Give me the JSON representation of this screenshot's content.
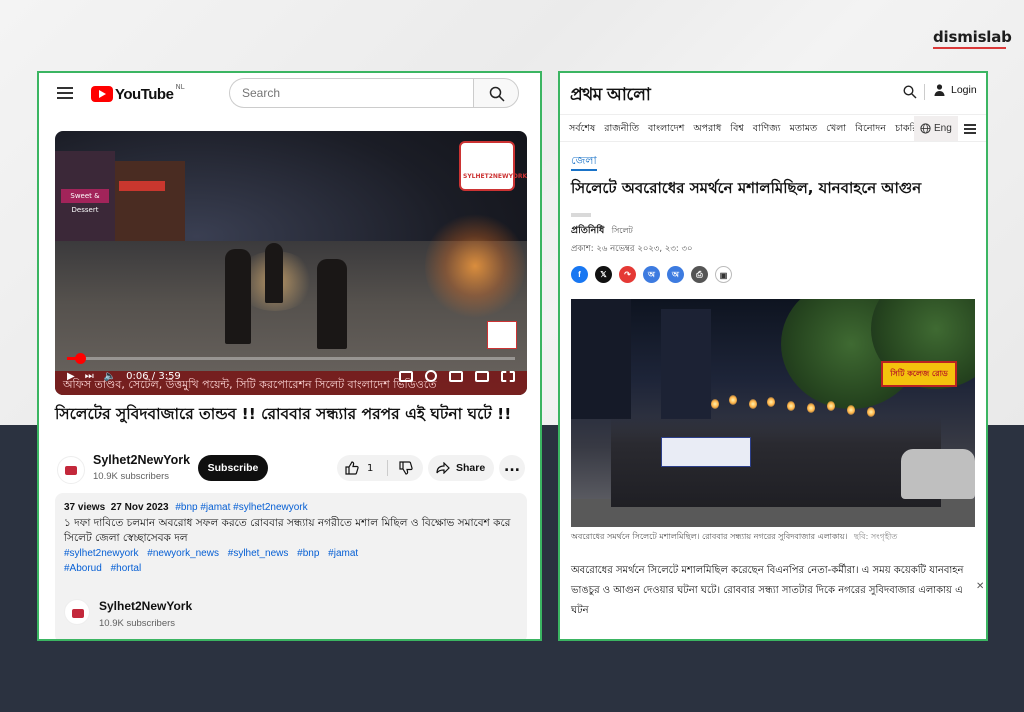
{
  "brand": {
    "name": "dismislab"
  },
  "youtube": {
    "logo_text": "YouTube",
    "region": "NL",
    "search": {
      "placeholder": "Search"
    },
    "video": {
      "shop_sign": "Sweet & Dessert",
      "badge_text": "SYLHET2NEWYORK",
      "ticker": "অফিস তাণ্ডব, সেটেল, উত্তমুখি পয়েন্ট, সিটি করপোরেশন সিলেট বাংলাদেশ ভিডিওতে",
      "time": "0:06 / 3:59",
      "progress": 0.028
    },
    "title": "সিলেটের সুবিদবাজারে তান্ডব !! রোববার সন্ধ্যার পরপর এই ঘটনা ঘটে !!",
    "channel": {
      "name": "Sylhet2NewYork",
      "subscribers": "10.9K subscribers"
    },
    "subscribe_label": "Subscribe",
    "likes": "1",
    "share_label": "Share",
    "more_label": "...",
    "description": {
      "views": "37 views",
      "date": "27 Nov 2023",
      "header_tags": "#bnp #jamat #sylhet2newyork",
      "text": "১ দফা দাবিতে চলমান অবরোধ সফল করতে রোববার সন্ধ্যায় নগরীতে মশাল মিছিল ও বিক্ষোভ সমাবেশ করে সিলেট জেলা স্বেচ্ছাসেবক দল",
      "tags": [
        "#sylhet2newyork",
        "#newyork_news",
        "#sylhet_news",
        "#bnp",
        "#jamat",
        "#Aborud",
        "#hortal"
      ],
      "channel_name": "Sylhet2NewYork",
      "channel_subscribers": "10.9K subscribers"
    }
  },
  "prothom_alo": {
    "logo_text": "প্রথম আলো",
    "login_label": "Login",
    "nav": [
      "সর্বশেষ",
      "রাজনীতি",
      "বাংলাদেশ",
      "অপরাধ",
      "বিশ্ব",
      "বাণিজ্য",
      "মতামত",
      "খেলা",
      "বিনোদন",
      "চাকরি"
    ],
    "lang_label": "Eng",
    "section": "জেলা",
    "headline": "সিলেটে অবরোধের সমর্থনে মশালমিছিল, যানবাহনে আগুন",
    "author": "প্রতিনিধি",
    "location": "সিলেট",
    "published": "প্রকাশ: ২৬ নভেম্বর ২০২৩, ২৩: ৩০",
    "photo_sign": "সিটি কলেজ রোড",
    "caption": "অবরোধের সমর্থনে সিলেটে মশালমিছিল। রোববার সন্ধ্যায় নগরের সুবিদবাজার এলাকায়।",
    "photo_credit": "ছবি: সংগৃহীত",
    "body": "অবরোধের সমর্থনে সিলেটে মশালমিছিল করেছেন বিএনপির নেতা-কর্মীরা। এ সময় কয়েকটি যানবাহন ভাঙচুর ও আগুন দেওয়ার ঘটনা ঘটে। রোববার সন্ধ্যা সাতটার দিকে নগরের সুবিদবাজার এলাকায় এ ঘটন",
    "share_icons": [
      "facebook",
      "x",
      "share",
      "audio-1",
      "audio-2",
      "print",
      "bookmark"
    ],
    "share_colors": [
      "#1877f2",
      "#111111",
      "#e53935",
      "#3d7be0",
      "#3d7be0",
      "#555555",
      "#ffffff"
    ],
    "share_glyphs": [
      "f",
      "𝕏",
      "↷",
      "অ",
      "অ",
      "⎙",
      "▣"
    ]
  }
}
